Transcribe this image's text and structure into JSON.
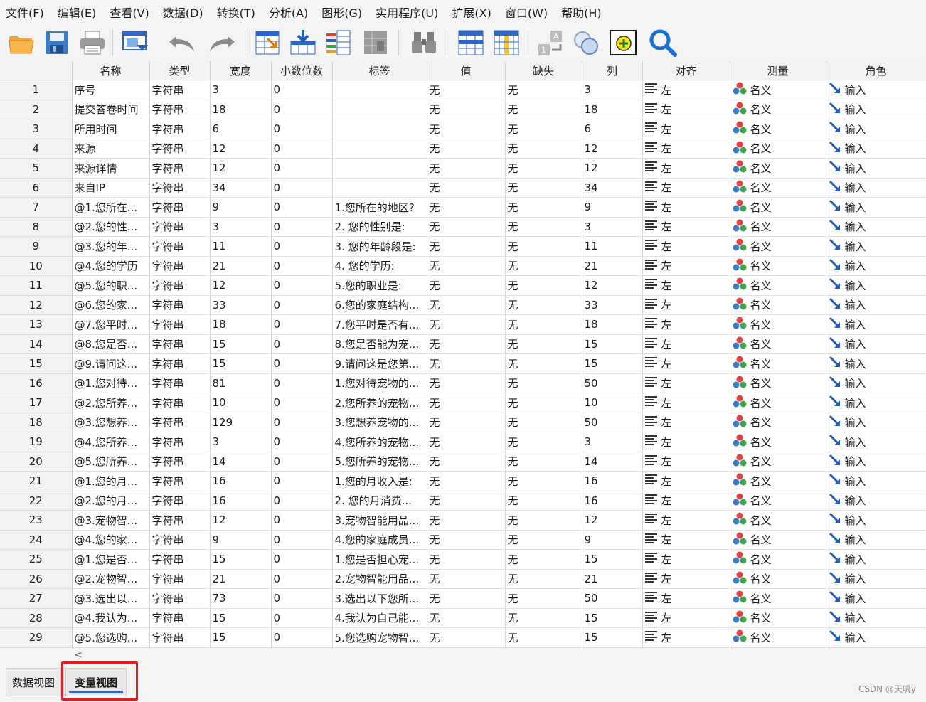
{
  "menu": [
    "文件(F)",
    "编辑(E)",
    "查看(V)",
    "数据(D)",
    "转换(T)",
    "分析(A)",
    "图形(G)",
    "实用程序(U)",
    "扩展(X)",
    "窗口(W)",
    "帮助(H)"
  ],
  "toolbar": [
    {
      "icon": "open-folder-icon"
    },
    {
      "icon": "save-disk-icon"
    },
    {
      "icon": "print-icon"
    },
    {
      "icon": "recall-dialog-icon"
    },
    {
      "icon": "undo-icon"
    },
    {
      "icon": "redo-icon"
    },
    {
      "icon": "goto-case-icon"
    },
    {
      "icon": "goto-variable-icon"
    },
    {
      "icon": "variables-icon"
    },
    {
      "icon": "run-descriptive-icon"
    },
    {
      "icon": "find-binoculars-icon"
    },
    {
      "icon": "insert-cases-icon"
    },
    {
      "icon": "insert-variable-icon"
    },
    {
      "icon": "split-file-icon"
    },
    {
      "icon": "weight-cases-icon"
    },
    {
      "icon": "select-cases-icon"
    },
    {
      "icon": "search-magnifier-icon"
    }
  ],
  "columns": [
    "名称",
    "类型",
    "宽度",
    "小数位数",
    "标签",
    "值",
    "缺失",
    "列",
    "对齐",
    "测量",
    "角色"
  ],
  "colors": {
    "accent": "#2f66c6",
    "highlight": "#e02020",
    "role_arrow": "#1f5fb8"
  },
  "rows": [
    {
      "num": "1",
      "name": "序号",
      "type": "字符串",
      "width": "3",
      "decimals": "0",
      "label": "",
      "values": "无",
      "missing": "无",
      "columns": "3",
      "align": "左",
      "measure": "名义",
      "role": "输入"
    },
    {
      "num": "2",
      "name": "提交答卷时间",
      "type": "字符串",
      "width": "18",
      "decimals": "0",
      "label": "",
      "values": "无",
      "missing": "无",
      "columns": "18",
      "align": "左",
      "measure": "名义",
      "role": "输入"
    },
    {
      "num": "3",
      "name": "所用时间",
      "type": "字符串",
      "width": "6",
      "decimals": "0",
      "label": "",
      "values": "无",
      "missing": "无",
      "columns": "6",
      "align": "左",
      "measure": "名义",
      "role": "输入"
    },
    {
      "num": "4",
      "name": "来源",
      "type": "字符串",
      "width": "12",
      "decimals": "0",
      "label": "",
      "values": "无",
      "missing": "无",
      "columns": "12",
      "align": "左",
      "measure": "名义",
      "role": "输入"
    },
    {
      "num": "5",
      "name": "来源详情",
      "type": "字符串",
      "width": "12",
      "decimals": "0",
      "label": "",
      "values": "无",
      "missing": "无",
      "columns": "12",
      "align": "左",
      "measure": "名义",
      "role": "输入"
    },
    {
      "num": "6",
      "name": "来自IP",
      "type": "字符串",
      "width": "34",
      "decimals": "0",
      "label": "",
      "values": "无",
      "missing": "无",
      "columns": "34",
      "align": "左",
      "measure": "名义",
      "role": "输入"
    },
    {
      "num": "7",
      "name": "@1.您所在...",
      "type": "字符串",
      "width": "9",
      "decimals": "0",
      "label": "1.您所在的地区?",
      "values": "无",
      "missing": "无",
      "columns": "9",
      "align": "左",
      "measure": "名义",
      "role": "输入"
    },
    {
      "num": "8",
      "name": "@2.您的性...",
      "type": "字符串",
      "width": "3",
      "decimals": "0",
      "label": "2. 您的性别是:",
      "values": "无",
      "missing": "无",
      "columns": "3",
      "align": "左",
      "measure": "名义",
      "role": "输入"
    },
    {
      "num": "9",
      "name": "@3.您的年...",
      "type": "字符串",
      "width": "11",
      "decimals": "0",
      "label": "3. 您的年龄段是:",
      "values": "无",
      "missing": "无",
      "columns": "11",
      "align": "左",
      "measure": "名义",
      "role": "输入"
    },
    {
      "num": "10",
      "name": "@4.您的学历",
      "type": "字符串",
      "width": "21",
      "decimals": "0",
      "label": "4. 您的学历:",
      "values": "无",
      "missing": "无",
      "columns": "21",
      "align": "左",
      "measure": "名义",
      "role": "输入"
    },
    {
      "num": "11",
      "name": "@5.您的职...",
      "type": "字符串",
      "width": "12",
      "decimals": "0",
      "label": "5.您的职业是:",
      "values": "无",
      "missing": "无",
      "columns": "12",
      "align": "左",
      "measure": "名义",
      "role": "输入"
    },
    {
      "num": "12",
      "name": "@6.您的家...",
      "type": "字符串",
      "width": "33",
      "decimals": "0",
      "label": "6.您的家庭结构...",
      "values": "无",
      "missing": "无",
      "columns": "33",
      "align": "左",
      "measure": "名义",
      "role": "输入"
    },
    {
      "num": "13",
      "name": "@7.您平时...",
      "type": "字符串",
      "width": "18",
      "decimals": "0",
      "label": "7.您平时是否有...",
      "values": "无",
      "missing": "无",
      "columns": "18",
      "align": "左",
      "measure": "名义",
      "role": "输入"
    },
    {
      "num": "14",
      "name": "@8.您是否...",
      "type": "字符串",
      "width": "15",
      "decimals": "0",
      "label": "8.您是否能为宠...",
      "values": "无",
      "missing": "无",
      "columns": "15",
      "align": "左",
      "measure": "名义",
      "role": "输入"
    },
    {
      "num": "15",
      "name": "@9.请问这...",
      "type": "字符串",
      "width": "15",
      "decimals": "0",
      "label": "9.请问这是您第...",
      "values": "无",
      "missing": "无",
      "columns": "15",
      "align": "左",
      "measure": "名义",
      "role": "输入"
    },
    {
      "num": "16",
      "name": "@1.您对待...",
      "type": "字符串",
      "width": "81",
      "decimals": "0",
      "label": "1.您对待宠物的...",
      "values": "无",
      "missing": "无",
      "columns": "50",
      "align": "左",
      "measure": "名义",
      "role": "输入"
    },
    {
      "num": "17",
      "name": "@2.您所养...",
      "type": "字符串",
      "width": "10",
      "decimals": "0",
      "label": "2.您所养的宠物...",
      "values": "无",
      "missing": "无",
      "columns": "10",
      "align": "左",
      "measure": "名义",
      "role": "输入"
    },
    {
      "num": "18",
      "name": "@3.您想养...",
      "type": "字符串",
      "width": "129",
      "decimals": "0",
      "label": "3.您想养宠物的...",
      "values": "无",
      "missing": "无",
      "columns": "50",
      "align": "左",
      "measure": "名义",
      "role": "输入"
    },
    {
      "num": "19",
      "name": "@4.您所养...",
      "type": "字符串",
      "width": "3",
      "decimals": "0",
      "label": "4.您所养的宠物...",
      "values": "无",
      "missing": "无",
      "columns": "3",
      "align": "左",
      "measure": "名义",
      "role": "输入"
    },
    {
      "num": "20",
      "name": "@5.您所养...",
      "type": "字符串",
      "width": "14",
      "decimals": "0",
      "label": "5.您所养的宠物...",
      "values": "无",
      "missing": "无",
      "columns": "14",
      "align": "左",
      "measure": "名义",
      "role": "输入"
    },
    {
      "num": "21",
      "name": "@1.您的月...",
      "type": "字符串",
      "width": "16",
      "decimals": "0",
      "label": "1.您的月收入是:",
      "values": "无",
      "missing": "无",
      "columns": "16",
      "align": "左",
      "measure": "名义",
      "role": "输入"
    },
    {
      "num": "22",
      "name": "@2.您的月...",
      "type": "字符串",
      "width": "16",
      "decimals": "0",
      "label": "2. 您的月消费...",
      "values": "无",
      "missing": "无",
      "columns": "16",
      "align": "左",
      "measure": "名义",
      "role": "输入"
    },
    {
      "num": "23",
      "name": "@3.宠物智...",
      "type": "字符串",
      "width": "12",
      "decimals": "0",
      "label": "3.宠物智能用品...",
      "values": "无",
      "missing": "无",
      "columns": "12",
      "align": "左",
      "measure": "名义",
      "role": "输入"
    },
    {
      "num": "24",
      "name": "@4.您的家...",
      "type": "字符串",
      "width": "9",
      "decimals": "0",
      "label": "4.您的家庭成员...",
      "values": "无",
      "missing": "无",
      "columns": "9",
      "align": "左",
      "measure": "名义",
      "role": "输入"
    },
    {
      "num": "25",
      "name": "@1.您是否...",
      "type": "字符串",
      "width": "15",
      "decimals": "0",
      "label": "1.您是否担心宠...",
      "values": "无",
      "missing": "无",
      "columns": "15",
      "align": "左",
      "measure": "名义",
      "role": "输入"
    },
    {
      "num": "26",
      "name": "@2.宠物智...",
      "type": "字符串",
      "width": "21",
      "decimals": "0",
      "label": "2.宠物智能用品...",
      "values": "无",
      "missing": "无",
      "columns": "21",
      "align": "左",
      "measure": "名义",
      "role": "输入"
    },
    {
      "num": "27",
      "name": "@3.选出以...",
      "type": "字符串",
      "width": "73",
      "decimals": "0",
      "label": "3.选出以下您所...",
      "values": "无",
      "missing": "无",
      "columns": "50",
      "align": "左",
      "measure": "名义",
      "role": "输入"
    },
    {
      "num": "28",
      "name": "@4.我认为...",
      "type": "字符串",
      "width": "15",
      "decimals": "0",
      "label": "4.我认为自己能...",
      "values": "无",
      "missing": "无",
      "columns": "15",
      "align": "左",
      "measure": "名义",
      "role": "输入"
    },
    {
      "num": "29",
      "name": "@5.您选购...",
      "type": "字符串",
      "width": "15",
      "decimals": "0",
      "label": "5.您选购宠物智...",
      "values": "无",
      "missing": "无",
      "columns": "15",
      "align": "左",
      "measure": "名义",
      "role": "输入"
    }
  ],
  "tabs": {
    "data_view": "数据视图",
    "variable_view": "变量视图"
  },
  "watermark": "CSDN @天叽y"
}
